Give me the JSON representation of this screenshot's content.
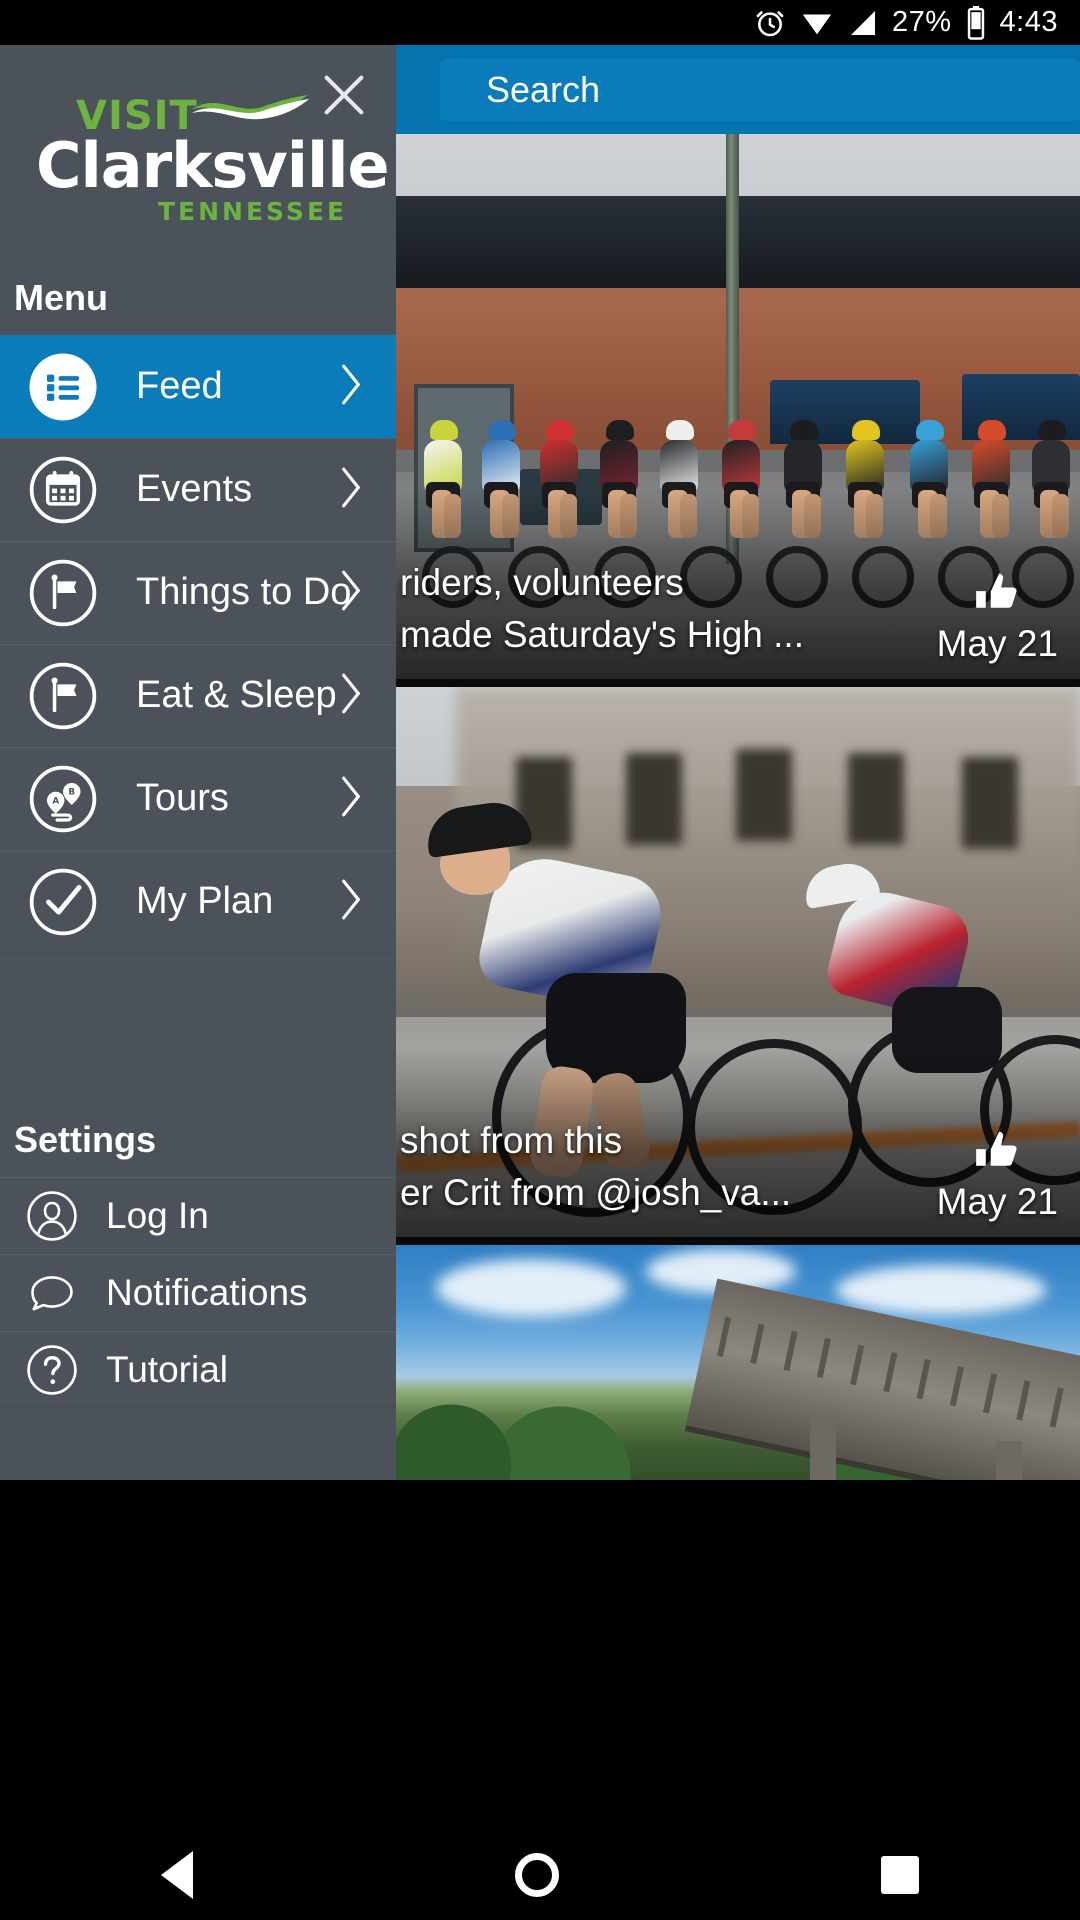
{
  "statusbar": {
    "alarm_icon": "alarm-clock-icon",
    "wifi_icon": "wifi-icon",
    "signal_icon": "cell-signal-icon",
    "battery_percent": "27%",
    "battery_icon": "battery-icon",
    "time": "4:43"
  },
  "search": {
    "placeholder": "Search"
  },
  "drawer": {
    "logo": {
      "visit": "VISIT",
      "name": "Clarksville",
      "state": "TENNESSEE"
    },
    "close_label": "×",
    "menu_header": "Menu",
    "menu_items": [
      {
        "label": "Feed",
        "icon": "list-icon",
        "active": true
      },
      {
        "label": "Events",
        "icon": "calendar-icon",
        "active": false
      },
      {
        "label": "Things to Do",
        "icon": "flag-icon",
        "active": false
      },
      {
        "label": "Eat & Sleep",
        "icon": "flag-icon",
        "active": false
      },
      {
        "label": "Tours",
        "icon": "map-pins-route-icon",
        "active": false
      },
      {
        "label": "My Plan",
        "icon": "check-circle-icon",
        "active": false
      }
    ],
    "settings_header": "Settings",
    "settings_items": [
      {
        "label": "Log In",
        "icon": "person-icon"
      },
      {
        "label": "Notifications",
        "icon": "speech-bubble-icon"
      },
      {
        "label": "Tutorial",
        "icon": "question-mark-icon"
      }
    ]
  },
  "feed": {
    "cards": [
      {
        "caption_line1": "riders, volunteers",
        "caption_line2": "made Saturday's High ...",
        "date": "May 21",
        "like_icon": "thumbs-up-icon",
        "image_alt": "cyclists-peloton-photo"
      },
      {
        "caption_line1": "shot from this",
        "caption_line2": "er Crit from @josh_va...",
        "date": "May 21",
        "like_icon": "thumbs-up-icon",
        "image_alt": "blurred-cyclist-photo"
      },
      {
        "caption_line1": "",
        "caption_line2": "",
        "date": "",
        "like_icon": "thumbs-up-icon",
        "image_alt": "railroad-trestle-bridge-photo"
      }
    ]
  },
  "navbar": {
    "back": "back-button",
    "home": "home-button",
    "recents": "recents-button"
  },
  "colors": {
    "accent_blue": "#0a7cba",
    "header_blue": "#0573ad",
    "drawer_gray": "#4c525a",
    "logo_green": "#6cb33f"
  }
}
